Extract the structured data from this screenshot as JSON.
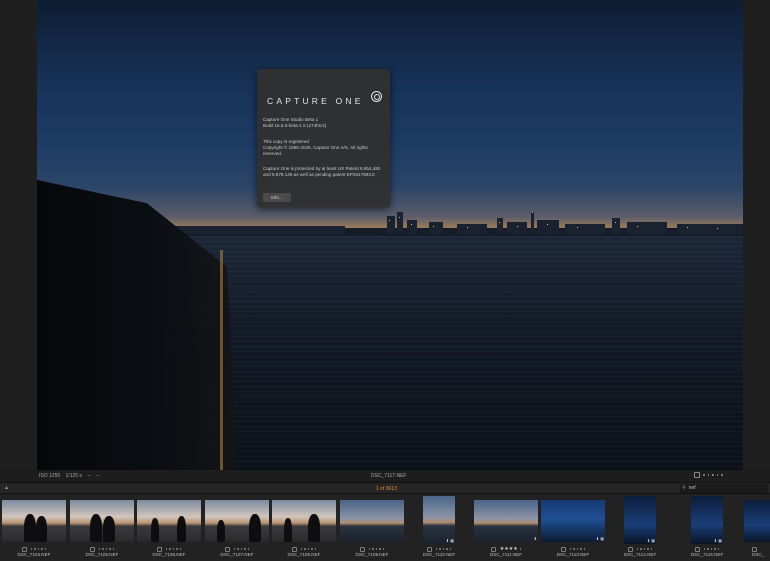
{
  "about": {
    "brand": "CAPTURE ONE",
    "product": "Capture One Studio  Beta 1",
    "build": "Build 16.6.0-beta-1.5 (274f4c2)",
    "registered": "This copy is registered",
    "copyright": "Copyright © 1995-2025, Capture One A/S. All rights reserved.",
    "patent": "Capture One is protected by at least US Patent 8,854,482 and 8,878,146 as well as pending patent EP2617883.0",
    "info_button": "Info..."
  },
  "status": {
    "iso": "ISO 1250",
    "shutter": "1/125 s",
    "aperture": "--",
    "focal": "--",
    "filename": "DSC_7117.NEF"
  },
  "browser": {
    "counter": "1 of 3613",
    "search_value": "nef"
  },
  "thumbnails": [
    {
      "name": "DSC_7104.NEF",
      "stars": ""
    },
    {
      "name": "DSC_7105.NEF",
      "stars": ""
    },
    {
      "name": "DSC_7106.NEF",
      "stars": ""
    },
    {
      "name": "DSC_7107.NEF",
      "stars": ""
    },
    {
      "name": "DSC_7108.NEF",
      "stars": ""
    },
    {
      "name": "DSC_7109.NEF",
      "stars": ""
    },
    {
      "name": "DSC_7110.NEF",
      "stars": ""
    },
    {
      "name": "DSC_7111.NEF",
      "stars": "★★★★"
    },
    {
      "name": "DSC_7113.NEF",
      "stars": ""
    },
    {
      "name": "DSC_7114.NEF",
      "stars": ""
    },
    {
      "name": "DSC_7115.NEF",
      "stars": ""
    },
    {
      "name": "DSC_",
      "stars": ""
    }
  ]
}
